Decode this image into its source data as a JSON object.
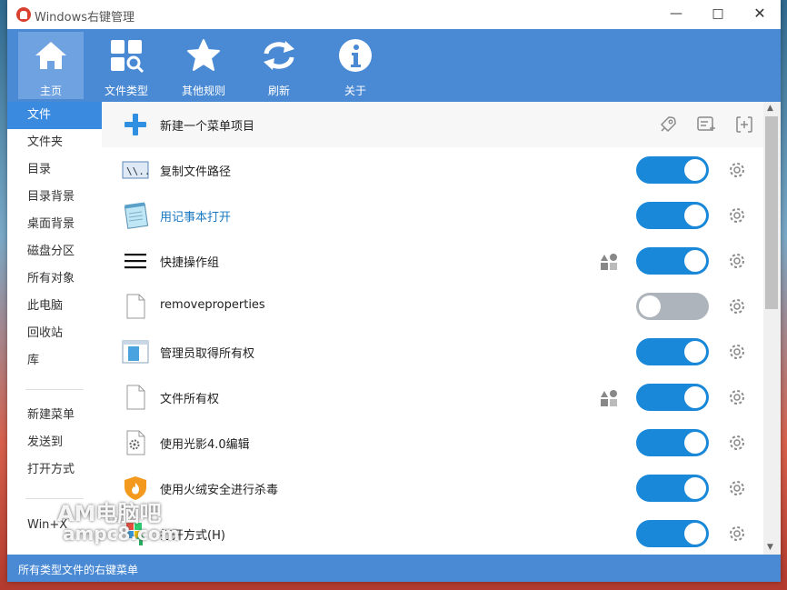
{
  "window": {
    "title": "Windows右键管理"
  },
  "toolbar": {
    "items": [
      {
        "label": "主页",
        "icon": "home-icon"
      },
      {
        "label": "文件类型",
        "icon": "file-type-search-icon"
      },
      {
        "label": "其他规则",
        "icon": "star-icon"
      },
      {
        "label": "刷新",
        "icon": "refresh-icon"
      },
      {
        "label": "关于",
        "icon": "info-icon"
      }
    ]
  },
  "sidebar": {
    "items": [
      "文件",
      "文件夹",
      "目录",
      "目录背景",
      "桌面背景",
      "磁盘分区",
      "所有对象",
      "此电脑",
      "回收站",
      "库"
    ],
    "items2": [
      "新建菜单",
      "发送到",
      "打开方式"
    ],
    "items3": [
      "Win+X"
    ],
    "selected": "文件"
  },
  "rows": [
    {
      "label": "新建一个菜单项目",
      "icon": "plus-icon"
    },
    {
      "label": "复制文件路径",
      "icon": "path-icon",
      "enabled": true
    },
    {
      "label": "用记事本打开",
      "icon": "notepad-icon",
      "enabled": true
    },
    {
      "label": "快捷操作组",
      "icon": "menu-lines-icon",
      "enabled": true,
      "group": true
    },
    {
      "label": "removeproperties",
      "icon": "blank-file-icon",
      "enabled": false
    },
    {
      "label": "管理员取得所有权",
      "icon": "window-icon",
      "enabled": true
    },
    {
      "label": "文件所有权",
      "icon": "blank-file-icon",
      "enabled": true,
      "group": true
    },
    {
      "label": "使用光影4.0编辑",
      "icon": "file-gear-icon",
      "enabled": true
    },
    {
      "label": "使用火绒安全进行杀毒",
      "icon": "shield-flame-icon",
      "enabled": true
    },
    {
      "label": "打开方式(H)",
      "icon": "open-with-icon",
      "enabled": true
    }
  ],
  "status": {
    "text": "所有类型文件的右键菜单"
  },
  "watermark": {
    "line1": "AM电脑吧",
    "line2": "ampc8.com"
  },
  "colors": {
    "accent": "#4a8ad4",
    "toggle_on": "#1a88d8",
    "toggle_off": "#aeb4bb"
  }
}
